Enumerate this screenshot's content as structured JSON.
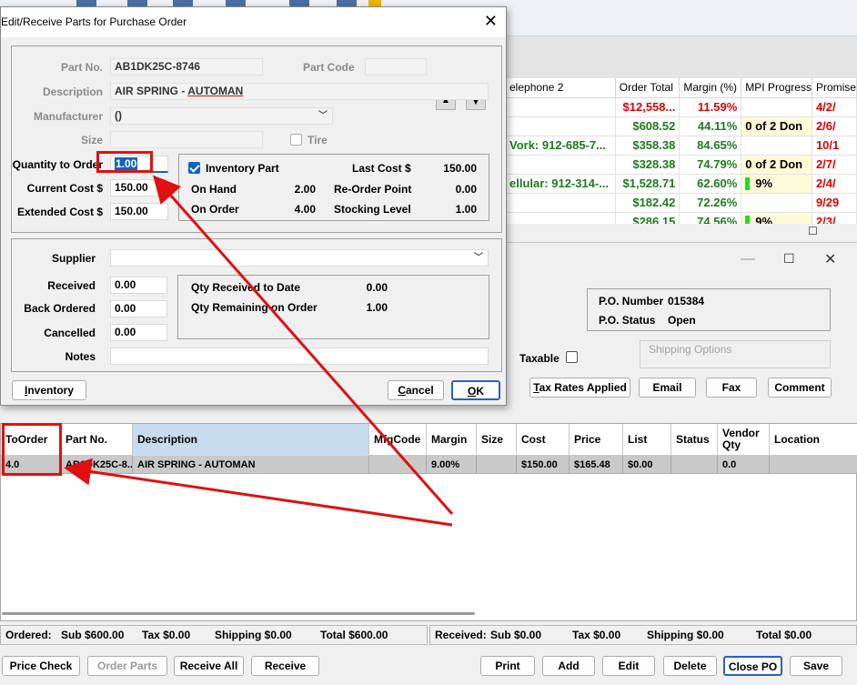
{
  "background_grid": {
    "headers": [
      "elephone 2",
      "Order Total",
      "Margin (%)",
      "MPI Progress",
      "Promise"
    ],
    "rows": [
      {
        "phone": "",
        "total": "$12,558...",
        "total_color": "red",
        "margin": "11.59%",
        "margin_color": "red",
        "mpi": "",
        "mpi_bar": false,
        "promise": "4/2/",
        "promise_color": "red"
      },
      {
        "phone": "",
        "total": "$608.52",
        "total_color": "green",
        "margin": "44.11%",
        "margin_color": "green",
        "mpi": "0 of 2 Don",
        "mpi_bar": false,
        "promise": "2/6/",
        "promise_color": "red"
      },
      {
        "phone": "Vork: 912-685-7...",
        "total": "$358.38",
        "total_color": "green",
        "margin": "84.65%",
        "margin_color": "green",
        "mpi": "",
        "mpi_bar": false,
        "promise": "10/1",
        "promise_color": "red"
      },
      {
        "phone": "",
        "total": "$328.38",
        "total_color": "green",
        "margin": "74.79%",
        "margin_color": "green",
        "mpi": "0 of 2 Don",
        "mpi_bar": false,
        "promise": "2/7/",
        "promise_color": "red"
      },
      {
        "phone": "ellular: 912-314-...",
        "total": "$1,528.71",
        "total_color": "green",
        "margin": "62.60%",
        "margin_color": "green",
        "mpi": "9%",
        "mpi_bar": true,
        "promise": "2/4/",
        "promise_color": "red"
      },
      {
        "phone": "",
        "total": "$182.42",
        "total_color": "green",
        "margin": "72.26%",
        "margin_color": "green",
        "mpi": "",
        "mpi_bar": false,
        "promise": "9/29",
        "promise_color": "red"
      },
      {
        "phone": "",
        "total": "$286.15",
        "total_color": "green",
        "margin": "74.56%",
        "margin_color": "green",
        "mpi": "9%",
        "mpi_bar": true,
        "promise": "2/3/",
        "promise_color": "red"
      }
    ]
  },
  "dialog": {
    "title": "Edit/Receive Parts for Purchase Order",
    "part_no_label": "Part No.",
    "part_no": "AB1DK25C-8746",
    "part_code_label": "Part Code",
    "part_code": "",
    "description_label": "Description",
    "description_prefix": "AIR SPRING - ",
    "description_underlined": "AUTOMAN",
    "manufacturer_label": "Manufacturer",
    "manufacturer": "()",
    "size_label": "Size",
    "size": "",
    "tire_label": "Tire",
    "qty_label": "Quantity to Order",
    "qty": "1.00",
    "current_cost_label": "Current Cost $",
    "current_cost": "150.00",
    "extended_cost_label": "Extended Cost $",
    "extended_cost": "150.00",
    "inventory": {
      "inventory_part_label": "Inventory Part",
      "last_cost_label": "Last Cost $",
      "last_cost": "150.00",
      "on_hand_label": "On Hand",
      "on_hand": "2.00",
      "reorder_label": "Re-Order Point",
      "reorder": "0.00",
      "on_order_label": "On Order",
      "on_order": "4.00",
      "stocking_label": "Stocking Level",
      "stocking": "1.00"
    },
    "supplier_label": "Supplier",
    "supplier": "",
    "received_label": "Received",
    "received": "0.00",
    "back_ordered_label": "Back Ordered",
    "back_ordered": "0.00",
    "cancelled_label": "Cancelled",
    "cancelled": "0.00",
    "notes_label": "Notes",
    "notes": "",
    "qty_received_label": "Qty Received to Date",
    "qty_received": "0.00",
    "qty_remaining_label": "Qty Remaining on Order",
    "qty_remaining": "1.00",
    "inventory_button": "Inventory",
    "cancel_button": "Cancel",
    "ok_button": "OK"
  },
  "po": {
    "po_number_label": "P.O. Number",
    "po_number": "015384",
    "po_status_label": "P.O. Status",
    "po_status": "Open",
    "taxable_label": "Taxable",
    "shipping_options_label": "Shipping Options",
    "tax_rates_button": "Tax Rates Applied",
    "email_button": "Email",
    "fax_button": "Fax",
    "comment_button": "Comment",
    "grid_headers": {
      "to_order": "ToOrder",
      "part_no": "Part No.",
      "description": "Description",
      "mfg_code": "MfgCode",
      "margin": "Margin",
      "size": "Size",
      "cost": "Cost",
      "price": "Price",
      "list": "List",
      "status": "Status",
      "vendor_qty": "Vendor Qty",
      "location": "Location"
    },
    "row": {
      "to_order": "4.0",
      "part_no": "AB1DK25C-8...",
      "description": "AIR SPRING - AUTOMAN",
      "mfg_code": "",
      "margin": "9.00%",
      "size": "",
      "cost": "$150.00",
      "price": "$165.48",
      "list": "$0.00",
      "status": "",
      "vendor_qty": "0.0",
      "location": ""
    },
    "ordered_label": "Ordered:",
    "ordered_sub": "Sub $600.00",
    "ordered_tax": "Tax $0.00",
    "ordered_shipping": "Shipping $0.00",
    "ordered_total": "Total $600.00",
    "received_label": "Received:",
    "received_sub": "Sub $0.00",
    "received_tax": "Tax $0.00",
    "received_shipping": "Shipping $0.00",
    "received_total": "Total $0.00",
    "buttons": {
      "price_check": "Price Check",
      "order_parts": "Order Parts",
      "receive_all": "Receive All",
      "receive": "Receive",
      "print": "Print",
      "add": "Add",
      "edit": "Edit",
      "delete": "Delete",
      "close_po": "Close PO",
      "save": "Save"
    }
  },
  "annotation_color": "#e01010"
}
